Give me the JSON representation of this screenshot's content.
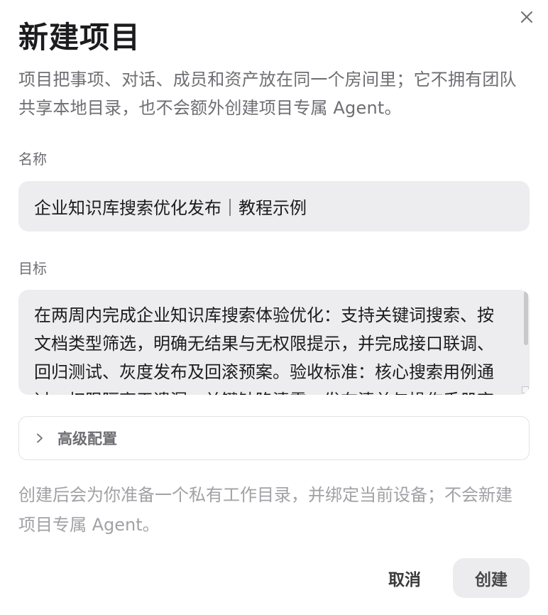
{
  "dialog": {
    "title": "新建项目",
    "description": "项目把事项、对话、成员和资产放在同一个房间里；它不拥有团队共享本地目录，也不会额外创建项目专属 Agent。",
    "close_icon": "close-icon"
  },
  "form": {
    "name_label": "名称",
    "name_value": "企业知识库搜索优化发布｜教程示例",
    "goal_label": "目标",
    "goal_value": "在两周内完成企业知识库搜索体验优化：支持关键词搜索、按文档类型筛选，明确无结果与无权限提示，并完成接口联调、回归测试、灰度发布及回滚预案。验收标准：核心搜索用例通过，权限隔离无遗漏，关键缺陷清零，发布清单与操作手册齐备。",
    "advanced_label": "高级配置",
    "advanced_icon": "chevron-right-icon"
  },
  "footer": {
    "note": "创建后会为你准备一个私有工作目录，并绑定当前设备；不会新建项目专属 Agent。",
    "cancel_label": "取消",
    "create_label": "创建"
  }
}
